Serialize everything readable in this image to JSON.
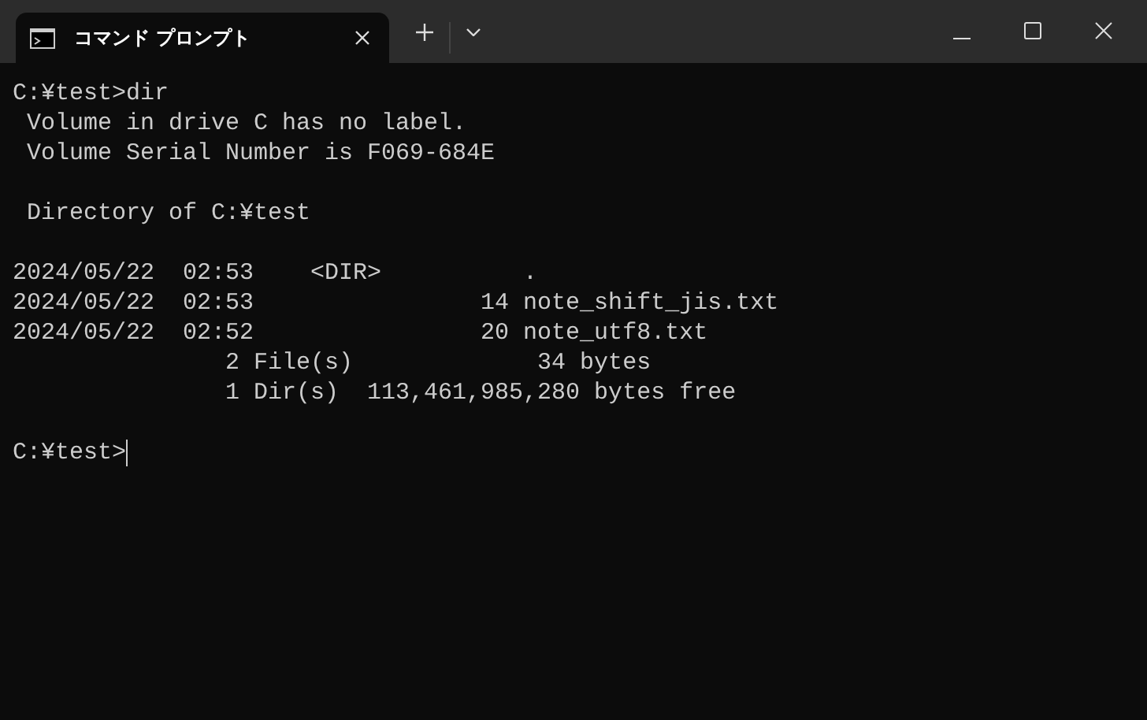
{
  "window": {
    "title": "コマンド プロンプト"
  },
  "console": {
    "blocks": [
      [
        "C:¥test>dir",
        " Volume in drive C has no label.",
        " Volume Serial Number is F069-684E"
      ],
      [
        " Directory of C:¥test"
      ],
      [
        "2024/05/22  02:53    <DIR>          .",
        "2024/05/22  02:53                14 note_shift_jis.txt",
        "2024/05/22  02:52                20 note_utf8.txt",
        "               2 File(s)             34 bytes",
        "               1 Dir(s)  113,461,985,280 bytes free"
      ]
    ],
    "prompt": {
      "text": "C:¥test>",
      "cursor": true
    }
  }
}
